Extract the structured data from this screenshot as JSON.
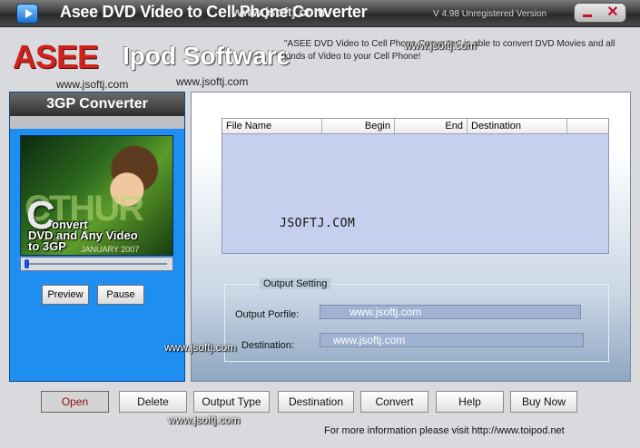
{
  "window": {
    "title": "Asee DVD Video to Cell Phone Converter",
    "title_overlay": "www.jsoftj.com",
    "version": "V 4.98 Unregistered Version"
  },
  "header": {
    "logo_brand": "ASEE",
    "logo_product": "Ipod Software",
    "description": "\"ASEE DVD Video to Cell Phone Converter\" is able to convert DVD Movies and all kinds of  Video to your Cell Phone!"
  },
  "watermarks": {
    "header_right": "www.jsoftj.com",
    "header_left": "www.jsoftj.com",
    "header_mid": "www.jsoftj.com",
    "left_panel": "www.jsoftj.com",
    "bottom": "www.jsoftj.com",
    "filelist": "JSOFTJ.COM"
  },
  "left_panel": {
    "title": "3GP Converter",
    "poster_caption_line1": "onvert",
    "poster_caption_line2": "DVD and Any Video",
    "poster_caption_line3": "to 3GP",
    "poster_big_letter": "C",
    "poster_bg_title": "CTHUR",
    "poster_date": "JANUARY 2007",
    "seek_position": 0.0,
    "preview_label": "Preview",
    "pause_label": "Pause"
  },
  "file_list": {
    "columns": [
      "File Name",
      "Begin",
      "End",
      "Destination"
    ],
    "rows": []
  },
  "output_setting": {
    "legend": "Output Setting",
    "profile_label": "Output Porfile:",
    "profile_value": "www.jsoftj.com",
    "destination_label": "Destination:",
    "destination_value": "www.jsoftj.com"
  },
  "toolbar": {
    "buttons": [
      "Open",
      "Delete",
      "Output Type",
      "Destination",
      "Convert",
      "Help",
      "Buy Now"
    ],
    "selected": "Open"
  },
  "footer": {
    "info": "For more information please visit http://www.toipod.net"
  },
  "colors": {
    "brand_red": "#d0211c",
    "left_panel_blue": "#1e8ef2",
    "filelist_bg": "#c7cfee",
    "selected_text": "#8b0d0d"
  }
}
